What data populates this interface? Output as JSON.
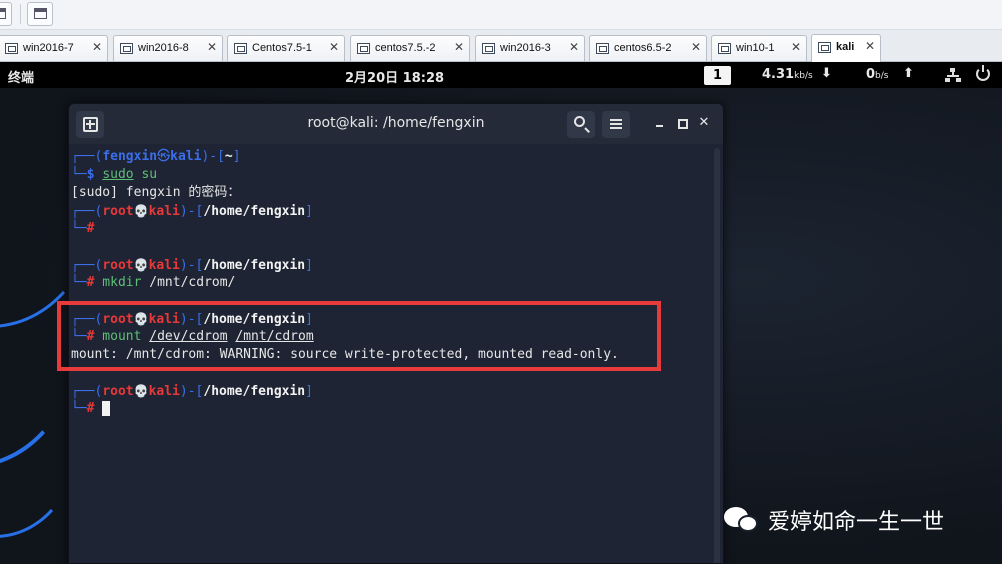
{
  "vm_tabs": [
    {
      "label": "win2016-7",
      "close": "✕"
    },
    {
      "label": "win2016-8",
      "close": "✕"
    },
    {
      "label": "Centos7.5-1",
      "close": "✕"
    },
    {
      "label": "centos7.5.-2",
      "close": "✕"
    },
    {
      "label": "win2016-3",
      "close": "✕"
    },
    {
      "label": "centos6.5-2",
      "close": "✕"
    },
    {
      "label": "win10-1",
      "close": "✕"
    },
    {
      "label": "kali",
      "close": "✕",
      "active": true
    }
  ],
  "guest_panel": {
    "app_name": "终端",
    "datetime": "2月20日 18:28",
    "workspace": "1",
    "download_value": "4.31",
    "download_unit": "kb/s",
    "download_arrow": "⬇",
    "upload_value": "0",
    "upload_unit": "b/s",
    "upload_arrow": "⬆"
  },
  "terminal": {
    "title": "root@kali: /home/fengxin",
    "close_glyph": "✕",
    "lines": {
      "l1": {
        "pre": "┌──(",
        "user": "fengxin",
        "sym": "㉿",
        "host": "kali",
        "mid": ")-[",
        "path": "~",
        "post": "]"
      },
      "l2": {
        "pre": "└─",
        "prompt": "$",
        "cmd1": "sudo",
        "cmd2": " su"
      },
      "l3": {
        "text": "[sudo] fengxin 的密码："
      },
      "l4": {
        "pre": "┌──(",
        "user": "root",
        "sym": "💀",
        "host": "kali",
        "mid": ")-[",
        "path": "/home/fengxin",
        "post": "]"
      },
      "l5": {
        "pre": "└─",
        "prompt": "#"
      },
      "l6": {
        "pre": "┌──(",
        "user": "root",
        "sym": "💀",
        "host": "kali",
        "mid": ")-[",
        "path": "/home/fengxin",
        "post": "]"
      },
      "l7": {
        "pre": "└─",
        "prompt": "#",
        "cmd": " mkdir",
        "args": " /mnt/cdrom/"
      },
      "l8": {
        "pre": "┌──(",
        "user": "root",
        "sym": "💀",
        "host": "kali",
        "mid": ")-[",
        "path": "/home/fengxin",
        "post": "]"
      },
      "l9": {
        "pre": "└─",
        "prompt": "#",
        "cmd": " mount",
        "sp1": " ",
        "arg1": "/dev/cdrom",
        "sp2": " ",
        "arg2": "/mnt/cdrom"
      },
      "l10": {
        "text": "mount: /mnt/cdrom: WARNING: source write-protected, mounted read-only."
      },
      "l11": {
        "pre": "┌──(",
        "user": "root",
        "sym": "💀",
        "host": "kali",
        "mid": ")-[",
        "path": "/home/fengxin",
        "post": "]"
      },
      "l12": {
        "pre": "└─",
        "prompt": "#"
      }
    }
  },
  "watermark": {
    "text": "爱婷如命一生一世"
  },
  "colors": {
    "prompt_blue": "#3b6ee8",
    "root_red": "#e83838",
    "cmd_green": "#5fbf77",
    "highlight_red": "#e73a3a",
    "kali_swirl_blue": "#2a7bff"
  }
}
